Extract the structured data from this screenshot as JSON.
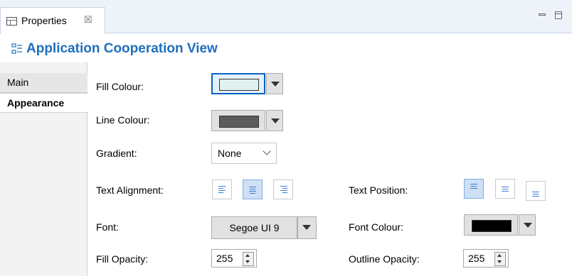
{
  "tab": {
    "label": "Properties",
    "close_glyph": "☒"
  },
  "header": {
    "title": "Application Cooperation View"
  },
  "nav": {
    "items": [
      {
        "label": "Main"
      },
      {
        "label": "Appearance"
      }
    ]
  },
  "form": {
    "fill_colour": {
      "label": "Fill Colour:",
      "value": "#dff0ee"
    },
    "line_colour": {
      "label": "Line Colour:",
      "value": "#5c5c5c"
    },
    "gradient": {
      "label": "Gradient:",
      "value": "None"
    },
    "text_alignment": {
      "label": "Text Alignment:",
      "selected": "center"
    },
    "text_position": {
      "label": "Text Position:",
      "selected": "top"
    },
    "font": {
      "label": "Font:",
      "value": "Segoe UI 9"
    },
    "font_colour": {
      "label": "Font Colour:",
      "value": "#000000"
    },
    "fill_opacity": {
      "label": "Fill Opacity:",
      "value": "255"
    },
    "outline_opacity": {
      "label": "Outline Opacity:",
      "value": "255"
    }
  },
  "colors": {
    "accent": "#1f6fbd",
    "tab_bar": "#eef3fa"
  }
}
